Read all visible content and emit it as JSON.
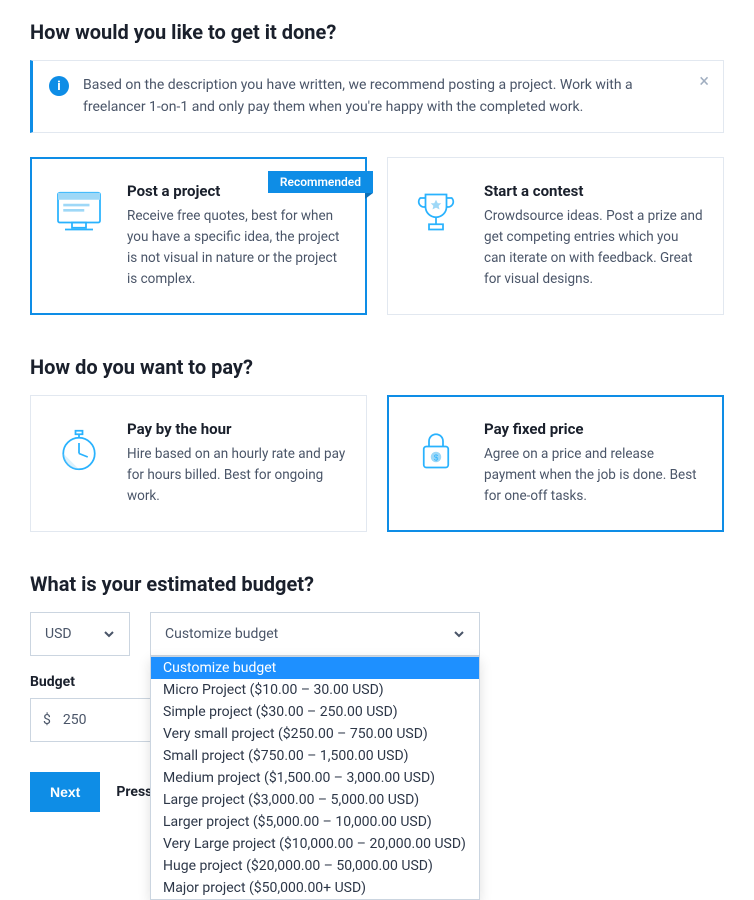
{
  "section1": {
    "heading": "How would you like to get it done?",
    "banner": "Based on the description you have written, we recommend posting a project. Work with a freelancer 1-on-1 and only pay them when you're happy with the completed work.",
    "ribbon": "Recommended",
    "cards": [
      {
        "title": "Post a project",
        "desc": "Receive free quotes, best for when you have a specific idea, the project is not visual in nature or the project is complex."
      },
      {
        "title": "Start a contest",
        "desc": "Crowdsource ideas. Post a prize and get competing entries which you can iterate on with feedback. Great for visual designs."
      }
    ]
  },
  "section2": {
    "heading": "How do you want to pay?",
    "cards": [
      {
        "title": "Pay by the hour",
        "desc": "Hire based on an hourly rate and pay for hours billed. Best for ongoing work."
      },
      {
        "title": "Pay fixed price",
        "desc": "Agree on a price and release payment when the job is done. Best for one-off tasks."
      }
    ]
  },
  "section3": {
    "heading": "What is your estimated budget?",
    "currency": "USD",
    "budget_select": "Customize budget",
    "budget_label": "Budget",
    "currency_symbol": "$",
    "budget_value": "250",
    "options": [
      "Customize budget",
      "Micro Project ($10.00 – 30.00 USD)",
      "Simple project ($30.00 – 250.00 USD)",
      "Very small project ($250.00 – 750.00 USD)",
      "Small project ($750.00 – 1,500.00 USD)",
      "Medium project ($1,500.00 – 3,000.00 USD)",
      "Large project ($3,000.00 – 5,000.00 USD)",
      "Larger project ($5,000.00 – 10,000.00 USD)",
      "Very Large project ($10,000.00 – 20,000.00 USD)",
      "Huge project ($20,000.00 – 50,000.00 USD)",
      "Major project ($50,000.00+ USD)"
    ]
  },
  "footer": {
    "next": "Next",
    "hint": "Press EN"
  }
}
